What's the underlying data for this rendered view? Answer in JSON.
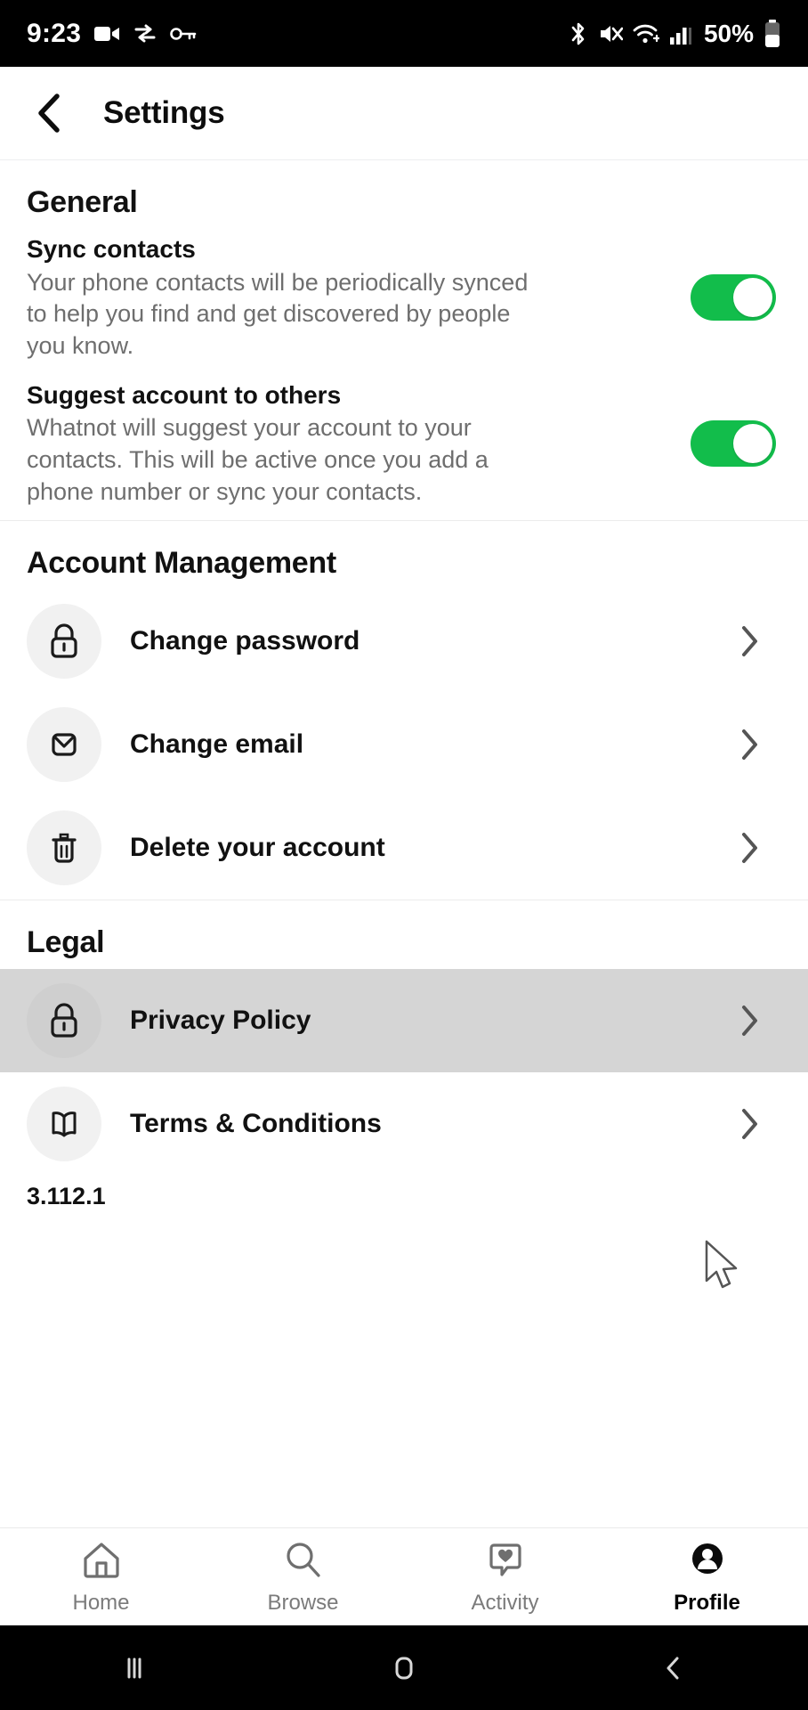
{
  "status_bar": {
    "time": "9:23",
    "battery_percent": "50%",
    "left_icons": [
      "video-camera-icon",
      "vpn-icon",
      "key-icon"
    ],
    "right_icons": [
      "bluetooth-icon",
      "mute-icon",
      "wifi-icon",
      "cellular-signal-icon",
      "battery-icon"
    ]
  },
  "header": {
    "title": "Settings",
    "back_icon": "back-chevron-icon"
  },
  "sections": {
    "general": {
      "title": "General",
      "toggles": [
        {
          "label": "Sync contacts",
          "description": "Your phone contacts will be periodically synced to help you find and get discovered by people you know.",
          "state": "on"
        },
        {
          "label": "Suggest account to others",
          "description": "Whatnot will suggest your account to your contacts. This will be active once you add a phone number or sync your contacts.",
          "state": "on"
        }
      ]
    },
    "account_management": {
      "title": "Account Management",
      "rows": [
        {
          "label": "Change password",
          "icon": "lock-icon"
        },
        {
          "label": "Change email",
          "icon": "envelope-icon"
        },
        {
          "label": "Delete your account",
          "icon": "trash-icon"
        }
      ]
    },
    "legal": {
      "title": "Legal",
      "rows": [
        {
          "label": "Privacy Policy",
          "icon": "lock-icon",
          "pressed": true
        },
        {
          "label": "Terms & Conditions",
          "icon": "open-book-icon",
          "pressed": false
        }
      ],
      "version": "3.112.1"
    }
  },
  "tab_bar": {
    "tabs": [
      {
        "label": "Home",
        "icon": "home-icon",
        "active": false
      },
      {
        "label": "Browse",
        "icon": "search-icon",
        "active": false
      },
      {
        "label": "Activity",
        "icon": "activity-heart-bubble-icon",
        "active": false
      },
      {
        "label": "Profile",
        "icon": "person-avatar-icon",
        "active": true
      }
    ]
  },
  "android_nav": {
    "buttons": [
      "recents-icon",
      "home-square-icon",
      "back-chevron-icon"
    ]
  },
  "colors": {
    "toggle_on": "#12bd4b",
    "pressed_row": "#d5d5d5",
    "icon_bubble": "#f1f1f1",
    "body_text": "#6e6e6e",
    "title_text": "#111111"
  }
}
